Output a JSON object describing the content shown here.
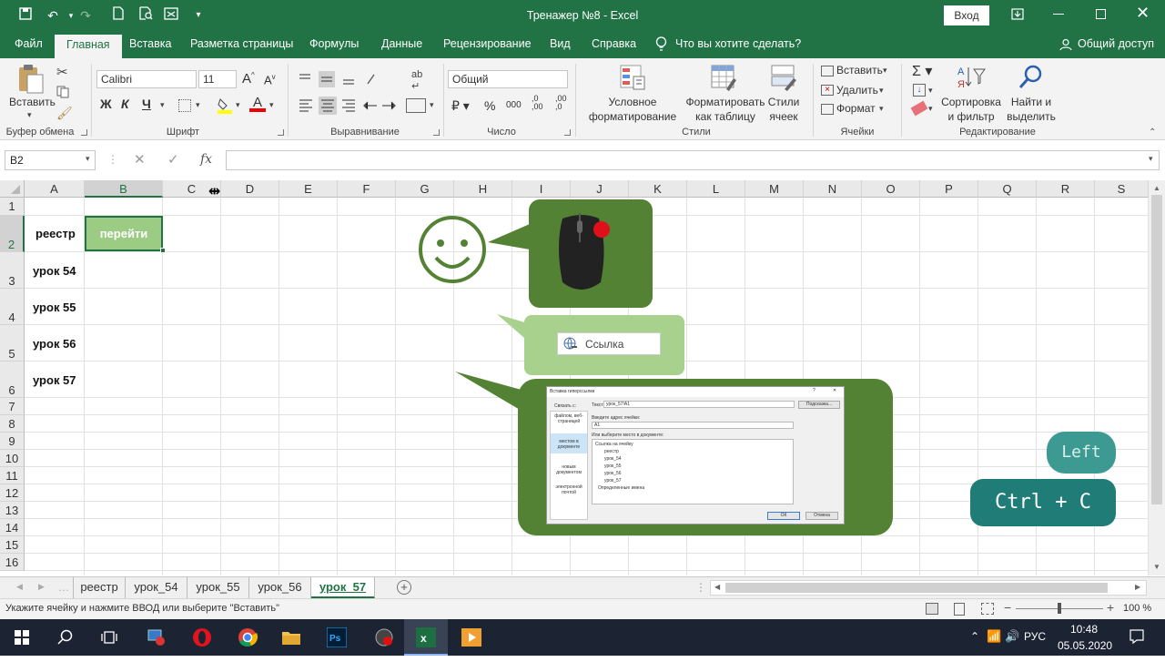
{
  "window": {
    "title": "Тренажер №8  -  Excel",
    "login_label": "Вход"
  },
  "tabs": [
    "Файл",
    "Главная",
    "Вставка",
    "Разметка страницы",
    "Формулы",
    "Данные",
    "Рецензирование",
    "Вид",
    "Справка"
  ],
  "tell_me": "Что вы хотите сделать?",
  "share": "Общий доступ",
  "ribbon": {
    "clipboard": {
      "paste": "Вставить",
      "label": "Буфер обмена"
    },
    "font": {
      "name": "Calibri",
      "size": "11",
      "bold": "Ж",
      "italic": "К",
      "underline": "Ч",
      "label": "Шрифт"
    },
    "alignment": {
      "label": "Выравнивание"
    },
    "number": {
      "format": "Общий",
      "label": "Число"
    },
    "styles": {
      "conditional": "Условное форматирование",
      "table": "Форматировать как таблицу",
      "cell": "Стили ячеек",
      "label": "Стили"
    },
    "cells": {
      "insert": "Вставить",
      "delete": "Удалить",
      "format": "Формат",
      "label": "Ячейки"
    },
    "editing": {
      "sort": "Сортировка и фильтр",
      "find": "Найти и выделить",
      "label": "Редактирование"
    }
  },
  "formula_bar": {
    "name_box": "B2",
    "fx": "fx",
    "value": ""
  },
  "columns": [
    "A",
    "B",
    "C",
    "D",
    "E",
    "F",
    "G",
    "H",
    "I",
    "J",
    "K",
    "L",
    "M",
    "N",
    "O",
    "P",
    "Q",
    "R",
    "S"
  ],
  "rows": [
    "1",
    "2",
    "3",
    "4",
    "5",
    "6",
    "7",
    "8",
    "9",
    "10",
    "11",
    "12",
    "13",
    "14",
    "15",
    "16"
  ],
  "cells": {
    "A2": "реестр",
    "B2": "перейти",
    "A3": "урок 54",
    "A4": "урок 55",
    "A5": "урок 56",
    "A6": "урок 57"
  },
  "overlay": {
    "link_popup": "Ссылка",
    "dialog": {
      "title": "Вставка гиперссылки",
      "link_with": "Связать с:",
      "text_label": "Текст:",
      "text_value": "урок_57!A1",
      "tooltip_btn": "Подсказка...",
      "address_label": "Введите адрес ячейки:",
      "address_value": "A1",
      "place_label": "Или выберите место в документе:",
      "sidebar": [
        "файлом, веб-страницей",
        "местом в документе",
        "новым документом",
        "электронной почтой"
      ],
      "tree": [
        "Ссылка на ячейку",
        "реестр",
        "урок_54",
        "урок_55",
        "урок_56",
        "урок_57",
        "Определенные имена"
      ],
      "ok": "ОК",
      "cancel": "Отмена"
    },
    "key_left": "Left",
    "key_copy": "Ctrl + C",
    "colors": {
      "bubble_dark": "#548235",
      "bubble_light": "#a9d18e",
      "smiley": "#548235",
      "key": "#1f7c77"
    }
  },
  "sheets": [
    "реестр",
    "урок_54",
    "урок_55",
    "урок_56",
    "урок_57"
  ],
  "active_sheet": "урок_57",
  "status": {
    "message": "Укажите ячейку и нажмите ВВОД или выберите \"Вставить\"",
    "zoom": "100 %"
  },
  "taskbar": {
    "lang": "РУС",
    "time": "10:48",
    "date": "05.05.2020"
  }
}
